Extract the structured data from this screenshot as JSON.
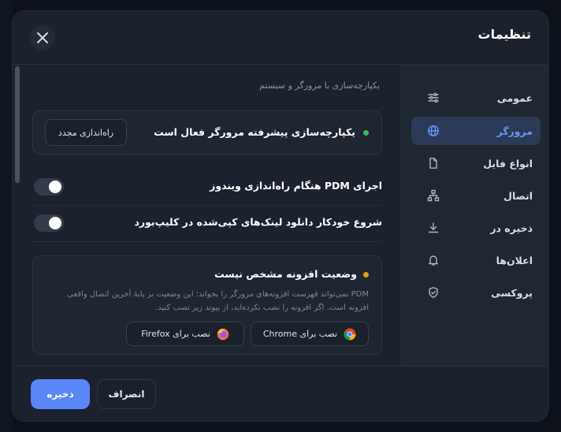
{
  "dialog": {
    "title": "تنظیمات",
    "close_icon": "close-icon"
  },
  "sidebar": {
    "items": [
      {
        "label": "عمومی",
        "icon": "sliders-icon",
        "active": false
      },
      {
        "label": "مرورگر",
        "icon": "globe-icon",
        "active": true
      },
      {
        "label": "انواع فایل",
        "icon": "file-icon",
        "active": false
      },
      {
        "label": "اتصال",
        "icon": "network-icon",
        "active": false
      },
      {
        "label": "ذخیره در",
        "icon": "download-icon",
        "active": false
      },
      {
        "label": "اعلان‌ها",
        "icon": "bell-icon",
        "active": false
      },
      {
        "label": "پروکسی",
        "icon": "shield-icon",
        "active": false
      }
    ]
  },
  "content": {
    "section_title": "یکپارچه‌سازی با مرورگر و سیستم",
    "integration_card": {
      "status_text": "یکپارچه‌سازی پیشرفته مرورگر فعال است",
      "status_color": "#3fb950",
      "restart_button": "راه‌اندازی مجدد"
    },
    "toggles": [
      {
        "label": "اجرای PDM هنگام راه‌اندازی ویندوز",
        "on": false
      },
      {
        "label": "شروع خودکار دانلود لینک‌های کپی‌شده در کلیپ‌بورد",
        "on": false
      }
    ],
    "extension_card": {
      "title": "وضعیت افزونه مشخص نیست",
      "status_color": "#e3a21a",
      "description": "PDM نمی‌تواند فهرست افزونه‌های مرورگر را بخواند؛ این وضعیت بر پایهٔ آخرین اتصال واقعی افزونه است. اگر افزونه را نصب نکرده‌اید، از پیوند زیر نصب کنید.",
      "chrome_button": "نصب برای Chrome",
      "firefox_button": "نصب برای Firefox"
    }
  },
  "footer": {
    "save_button": "ذخیره",
    "cancel_button": "انصراف"
  },
  "colors": {
    "accent": "#5b86f7",
    "active_nav_bg": "#2b3a56",
    "active_nav_text": "#6f94ff"
  }
}
